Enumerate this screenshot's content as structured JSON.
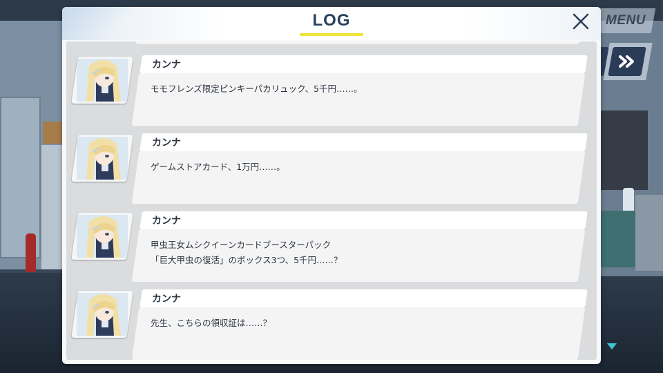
{
  "hud": {
    "menu_label": "MENU"
  },
  "log": {
    "title": "LOG",
    "entries": [
      {
        "speaker": "カンナ",
        "lines": [
          "モモフレンズ限定ピンキーパカリュック、5千円……。",
          ""
        ]
      },
      {
        "speaker": "カンナ",
        "lines": [
          "ゲームストアカード、1万円……。",
          ""
        ]
      },
      {
        "speaker": "カンナ",
        "lines": [
          "甲虫王女ムシクイーンカードブースターパック",
          "「巨大甲虫の復活」のボックス3つ、5千円……？"
        ]
      },
      {
        "speaker": "カンナ",
        "lines": [
          "先生、こちらの領収証は……？",
          ""
        ]
      }
    ]
  },
  "colors": {
    "title": "#2a3f5c",
    "underline": "#f0e33a",
    "button_dark": "#2a3c56",
    "scroll_indicator": "#3cc6d2"
  }
}
